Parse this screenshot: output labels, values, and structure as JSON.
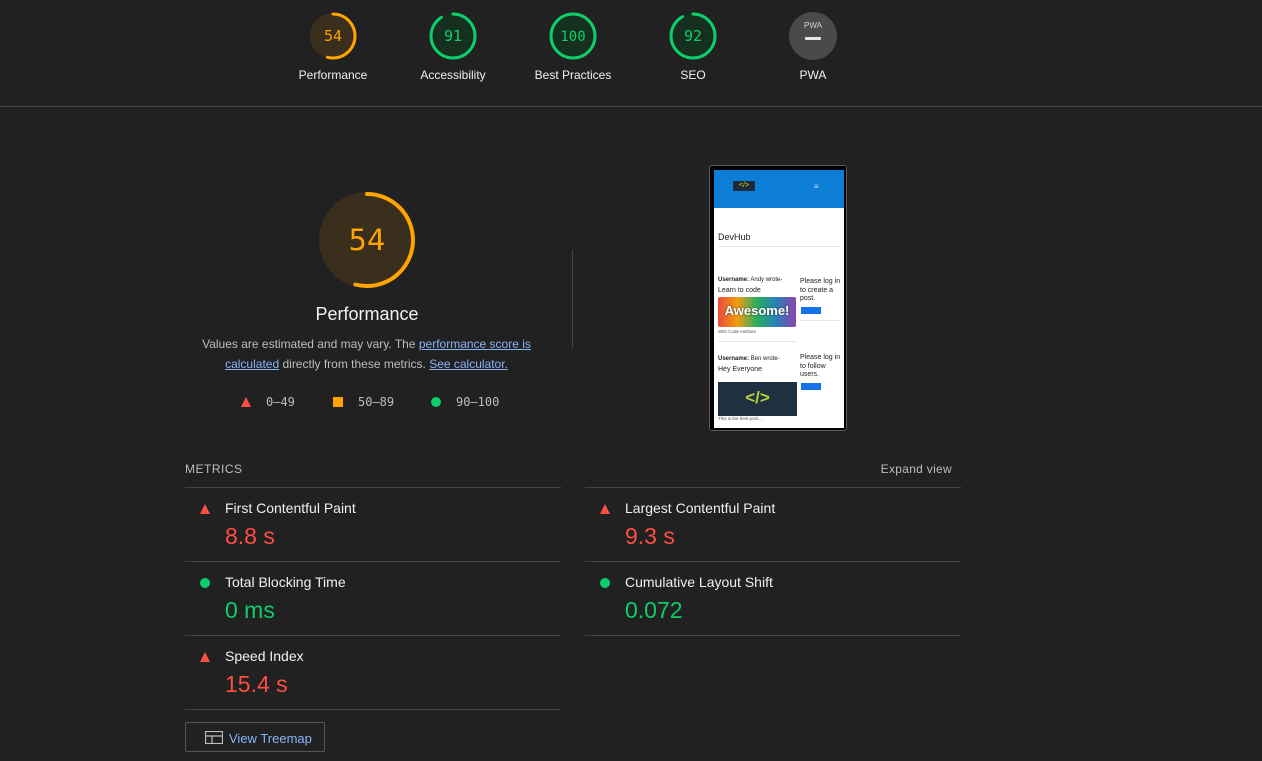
{
  "colors": {
    "fail": "#ff4e42",
    "average": "#ffa400",
    "pass": "#0cce6b",
    "link": "#8ab4f8",
    "background": "#212121"
  },
  "gauges": [
    {
      "label": "Performance",
      "score": "54",
      "level": 0.54,
      "status": "average"
    },
    {
      "label": "Accessibility",
      "score": "91",
      "level": 0.91,
      "status": "pass"
    },
    {
      "label": "Best Practices",
      "score": "100",
      "level": 1.0,
      "status": "pass"
    },
    {
      "label": "SEO",
      "score": "92",
      "level": 0.92,
      "status": "pass"
    },
    {
      "label": "PWA",
      "score": "",
      "level": 0,
      "status": "na",
      "badge_text": "PWA",
      "icon": "pwa-dash-icon"
    }
  ],
  "performance": {
    "score": "54",
    "level": 0.54,
    "title": "Performance",
    "desc_prefix": "Values are estimated and may vary. The ",
    "desc_link1": "performance score is calculated",
    "desc_middle": " directly from these metrics. ",
    "desc_link2": "See calculator.",
    "legend": [
      {
        "icon": "triangle-icon",
        "range": "0–49"
      },
      {
        "icon": "square-icon",
        "range": "50–89"
      },
      {
        "icon": "circle-icon",
        "range": "90–100"
      }
    ]
  },
  "screenshot": {
    "logo_text": "</>",
    "menu_icon": "≡",
    "brand": "DevHub",
    "post1_user_label": "Username:",
    "post1_user": " Andy wrote-",
    "post1_text": "Learn to code",
    "post1_image_text": "Awesome!",
    "post1_footer": "With Code Institute",
    "post2_user_label": "Username:",
    "post2_user": " Ben wrote-",
    "post2_text": "Hey Everyone",
    "post2_image_text": "</>",
    "post2_footer": "This is the best post....",
    "side1": "Please log in to create a post.",
    "side2": "Please log in to follow users."
  },
  "metrics": {
    "title": "METRICS",
    "expand_label": "Expand view",
    "items": [
      {
        "name": "First Contentful Paint",
        "value": "8.8 s",
        "status": "fail"
      },
      {
        "name": "Largest Contentful Paint",
        "value": "9.3 s",
        "status": "fail"
      },
      {
        "name": "Total Blocking Time",
        "value": "0 ms",
        "status": "pass"
      },
      {
        "name": "Cumulative Layout Shift",
        "value": "0.072",
        "status": "pass"
      },
      {
        "name": "Speed Index",
        "value": "15.4 s",
        "status": "fail"
      }
    ]
  },
  "treemap": {
    "label": "View Treemap"
  }
}
